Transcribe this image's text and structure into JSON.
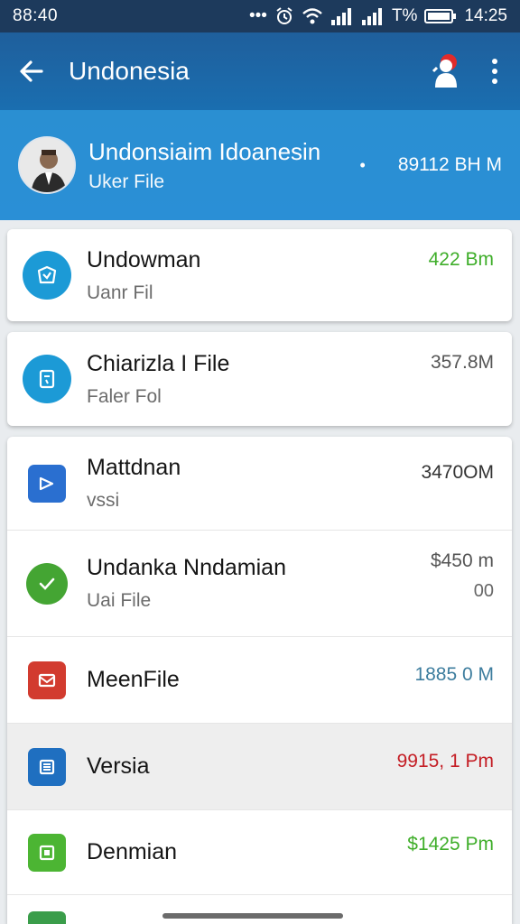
{
  "status_bar": {
    "time_left": "88:40",
    "dots": "•••",
    "battery_text": "T%",
    "time_right": "14:25"
  },
  "app_bar": {
    "title": "Undonesia",
    "icons": [
      "back-arrow-icon",
      "user-icon",
      "more-vert-icon"
    ]
  },
  "header": {
    "title": "Undonsiaim Idoanesin",
    "subtitle": "Uker File",
    "dot": "•",
    "size": "89112 BH M"
  },
  "cards": [
    {
      "title": "Undowman",
      "subtitle": "Uanr Fil",
      "size": "422 Bm",
      "size_color": "#3fae2a",
      "icon": "folder-icon"
    },
    {
      "title": "Chiarizla I File",
      "subtitle": "Faler Fol",
      "size": "357.8M",
      "size_color": "#555555",
      "icon": "file-icon"
    }
  ],
  "list": [
    {
      "title": "Mattdnan",
      "subtitle": "vssi",
      "size": "3470OM",
      "size_color": "#333333",
      "icon": "video-icon",
      "icon_color": "#2a6fd0"
    },
    {
      "title": "Undanka Nndamian",
      "subtitle": "Uai File",
      "size": "$450 m",
      "size_extra": "00",
      "size_color": "#555555",
      "icon": "check-icon",
      "icon_color": "#44a533"
    },
    {
      "title": "MeenFile",
      "subtitle": "",
      "size": "1885 0 M",
      "size_color": "#3d7d9e",
      "icon": "mail-icon",
      "icon_color": "#d23b2f"
    },
    {
      "title": "Versia",
      "subtitle": "",
      "size": "9915, 1 Pm",
      "size_color": "#c41d24",
      "icon": "document-icon",
      "icon_color": "#1f6fc0"
    },
    {
      "title": "Denmian",
      "subtitle": "",
      "size": "$1425 Pm",
      "size_color": "#3fae2a",
      "icon": "image-icon",
      "icon_color": "#4cb533"
    }
  ]
}
